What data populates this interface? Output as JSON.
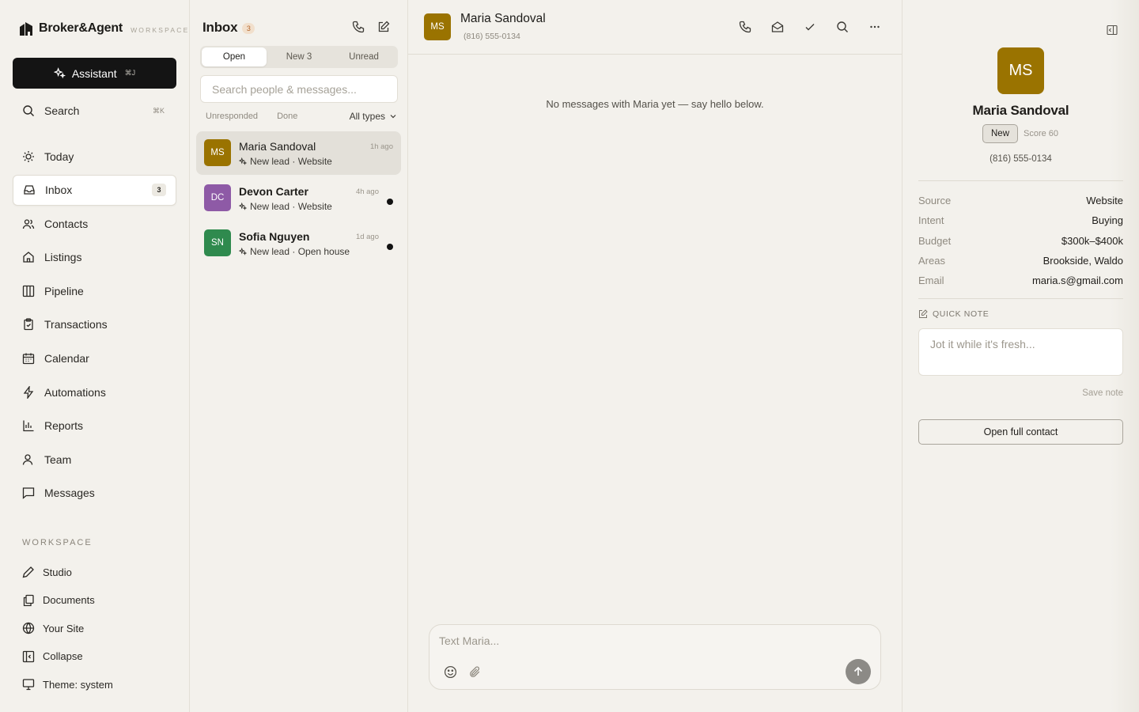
{
  "brand": {
    "name": "Broker&Agent",
    "tagline": "WORKSPACE"
  },
  "sidebar": {
    "assistant": {
      "label": "Assistant",
      "shortcut": "⌘J"
    },
    "search": {
      "label": "Search",
      "shortcut": "⌘K"
    },
    "nav": [
      {
        "label": "Today",
        "icon": "sun-icon"
      },
      {
        "label": "Inbox",
        "icon": "inbox-icon",
        "count": "3",
        "active": true
      },
      {
        "label": "Contacts",
        "icon": "users-icon"
      },
      {
        "label": "Listings",
        "icon": "home-icon"
      },
      {
        "label": "Pipeline",
        "icon": "columns-icon"
      },
      {
        "label": "Transactions",
        "icon": "clipboard-icon"
      },
      {
        "label": "Calendar",
        "icon": "calendar-icon"
      },
      {
        "label": "Automations",
        "icon": "bolt-icon"
      },
      {
        "label": "Reports",
        "icon": "bar-chart-icon"
      },
      {
        "label": "Team",
        "icon": "user-icon"
      },
      {
        "label": "Messages",
        "icon": "message-icon"
      }
    ],
    "workspace_label": "WORKSPACE",
    "workspace": [
      {
        "label": "Studio",
        "icon": "pen-icon"
      },
      {
        "label": "Documents",
        "icon": "documents-icon"
      },
      {
        "label": "Your Site",
        "icon": "globe-icon"
      },
      {
        "label": "Collapse",
        "icon": "collapse-icon"
      },
      {
        "label": "Theme: system",
        "icon": "monitor-icon"
      }
    ]
  },
  "inbox": {
    "title": "Inbox",
    "badge": "3",
    "tabs": [
      {
        "label": "Open",
        "active": true
      },
      {
        "label": "New 3"
      },
      {
        "label": "Unread"
      }
    ],
    "search_placeholder": "Search people & messages...",
    "filters": {
      "unresponded": "Unresponded",
      "done": "Done",
      "types": "All types"
    },
    "conversations": [
      {
        "initials": "MS",
        "name": "Maria Sandoval",
        "subtitle": "New lead · Website",
        "time": "1h ago",
        "color": "#9a7300",
        "unread": false,
        "active": true
      },
      {
        "initials": "DC",
        "name": "Devon Carter",
        "subtitle": "New lead · Website",
        "time": "4h ago",
        "color": "#8e5aa6",
        "unread": true,
        "active": false
      },
      {
        "initials": "SN",
        "name": "Sofia Nguyen",
        "subtitle": "New lead · Open house",
        "time": "1d ago",
        "color": "#2f8a4e",
        "unread": true,
        "active": false
      }
    ]
  },
  "chat": {
    "initials": "MS",
    "name": "Maria Sandoval",
    "phone": "(816) 555-0134",
    "empty_message": "No messages with Maria yet — say hello below.",
    "composer_placeholder": "Text Maria..."
  },
  "contact": {
    "initials": "MS",
    "name": "Maria Sandoval",
    "status": "New",
    "score": "Score 60",
    "phone": "(816) 555-0134",
    "details": [
      {
        "key": "Source",
        "value": "Website"
      },
      {
        "key": "Intent",
        "value": "Buying"
      },
      {
        "key": "Budget",
        "value": "$300k–$400k"
      },
      {
        "key": "Areas",
        "value": "Brookside, Waldo"
      },
      {
        "key": "Email",
        "value": "maria.s@gmail.com"
      }
    ],
    "quick_note_label": "QUICK NOTE",
    "quick_note_placeholder": "Jot it while it's fresh...",
    "save_note": "Save note",
    "open_full_contact": "Open full contact"
  },
  "colors": {
    "accent_dark": "#141414",
    "avatar_gold": "#9a7300",
    "avatar_purple": "#8e5aa6",
    "avatar_green": "#2f8a4e",
    "badge_orange": "#b5662a"
  }
}
